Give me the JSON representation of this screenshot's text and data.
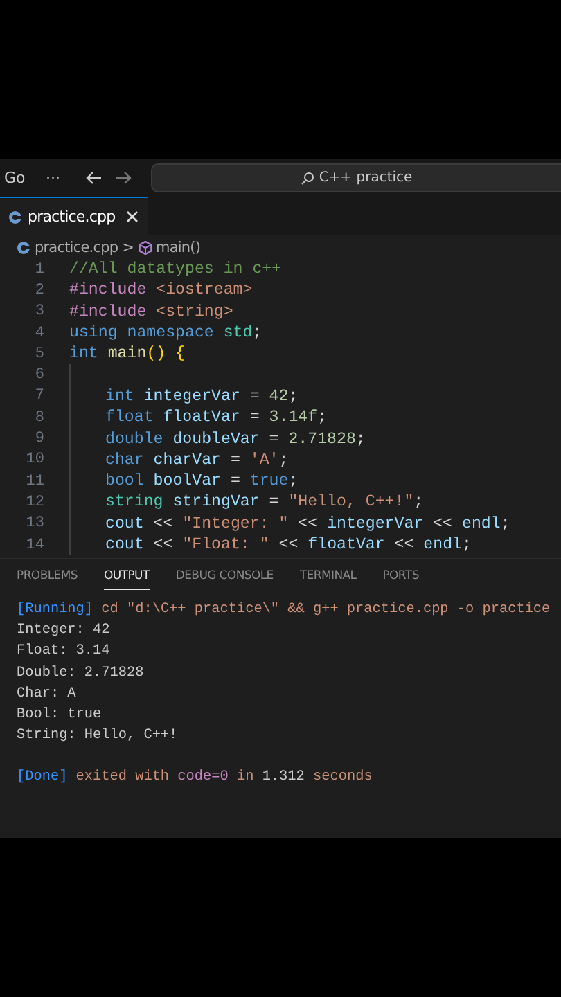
{
  "title_bar": {
    "menu": "Go",
    "more": "···",
    "search": "C++ practice"
  },
  "tabs": [
    {
      "label": "practice.cpp",
      "selected": true
    }
  ],
  "breadcrumbs": {
    "file": "practice.cpp",
    "separator": ">",
    "symbol": "main()"
  },
  "code": {
    "lines": [
      {
        "number": "1",
        "indent": false,
        "tokens": [
          {
            "text": "//All datatypes in c++",
            "kind": "comment"
          }
        ]
      },
      {
        "number": "2",
        "indent": false,
        "tokens": [
          {
            "text": "#include ",
            "kind": "directive"
          },
          {
            "text": "<iostream>",
            "kind": "string"
          }
        ]
      },
      {
        "number": "3",
        "indent": false,
        "tokens": [
          {
            "text": "#include ",
            "kind": "directive"
          },
          {
            "text": "<string>",
            "kind": "string"
          }
        ]
      },
      {
        "number": "4",
        "indent": false,
        "tokens": [
          {
            "text": "using namespace ",
            "kind": "keyword"
          },
          {
            "text": "std",
            "kind": "type"
          },
          {
            "text": ";",
            "kind": "plain"
          }
        ]
      },
      {
        "number": "5",
        "indent": false,
        "tokens": [
          {
            "text": "int ",
            "kind": "keyword"
          },
          {
            "text": "main",
            "kind": "function"
          },
          {
            "text": "() ",
            "kind": "bracket"
          },
          {
            "text": "{",
            "kind": "bracket"
          }
        ]
      },
      {
        "number": "6",
        "indent": true
      },
      {
        "number": "7",
        "indent": true,
        "tokens": [
          {
            "text": "int ",
            "kind": "keyword"
          },
          {
            "text": "integerVar",
            "kind": "variable"
          },
          {
            "text": " = ",
            "kind": "plain"
          },
          {
            "text": "42",
            "kind": "number"
          },
          {
            "text": ";",
            "kind": "plain"
          }
        ]
      },
      {
        "number": "8",
        "indent": true,
        "tokens": [
          {
            "text": "float ",
            "kind": "keyword"
          },
          {
            "text": "floatVar",
            "kind": "variable"
          },
          {
            "text": " = ",
            "kind": "plain"
          },
          {
            "text": "3.14f",
            "kind": "number"
          },
          {
            "text": ";",
            "kind": "plain"
          }
        ]
      },
      {
        "number": "9",
        "indent": true,
        "tokens": [
          {
            "text": "double ",
            "kind": "keyword"
          },
          {
            "text": "doubleVar",
            "kind": "variable"
          },
          {
            "text": " = ",
            "kind": "plain"
          },
          {
            "text": "2.71828",
            "kind": "number"
          },
          {
            "text": ";",
            "kind": "plain"
          }
        ]
      },
      {
        "number": "10",
        "indent": true,
        "tokens": [
          {
            "text": "char ",
            "kind": "keyword"
          },
          {
            "text": "charVar",
            "kind": "variable"
          },
          {
            "text": " = ",
            "kind": "plain"
          },
          {
            "text": "'A'",
            "kind": "string"
          },
          {
            "text": ";",
            "kind": "plain"
          }
        ]
      },
      {
        "number": "11",
        "indent": true,
        "tokens": [
          {
            "text": "bool ",
            "kind": "keyword"
          },
          {
            "text": "boolVar",
            "kind": "variable"
          },
          {
            "text": " = ",
            "kind": "plain"
          },
          {
            "text": "true",
            "kind": "keyword"
          },
          {
            "text": ";",
            "kind": "plain"
          }
        ]
      },
      {
        "number": "12",
        "indent": true,
        "tokens": [
          {
            "text": "string ",
            "kind": "type"
          },
          {
            "text": "stringVar",
            "kind": "variable"
          },
          {
            "text": " = ",
            "kind": "plain"
          },
          {
            "text": "\"Hello, C++!\"",
            "kind": "string"
          },
          {
            "text": ";",
            "kind": "plain"
          }
        ]
      },
      {
        "number": "13",
        "indent": true,
        "tokens": [
          {
            "text": "cout",
            "kind": "variable"
          },
          {
            "text": " << ",
            "kind": "plain"
          },
          {
            "text": "\"Integer: \"",
            "kind": "string"
          },
          {
            "text": " << ",
            "kind": "plain"
          },
          {
            "text": "integerVar",
            "kind": "variable"
          },
          {
            "text": " << ",
            "kind": "plain"
          },
          {
            "text": "endl",
            "kind": "variable"
          },
          {
            "text": ";",
            "kind": "plain"
          }
        ]
      },
      {
        "number": "14",
        "indent": true,
        "tokens": [
          {
            "text": "cout",
            "kind": "variable"
          },
          {
            "text": " << ",
            "kind": "plain"
          },
          {
            "text": "\"Float: \"",
            "kind": "string"
          },
          {
            "text": " << ",
            "kind": "plain"
          },
          {
            "text": "floatVar",
            "kind": "variable"
          },
          {
            "text": " << ",
            "kind": "plain"
          },
          {
            "text": "endl",
            "kind": "variable"
          },
          {
            "text": ";",
            "kind": "plain"
          }
        ]
      }
    ]
  },
  "panel": {
    "tabs": [
      {
        "label": "PROBLEMS",
        "selected": false
      },
      {
        "label": "OUTPUT",
        "selected": true
      },
      {
        "label": "DEBUG CONSOLE",
        "selected": false
      },
      {
        "label": "TERMINAL",
        "selected": false
      },
      {
        "label": "PORTS",
        "selected": false
      }
    ],
    "output": [
      {
        "tokens": [
          {
            "text": "[Running]",
            "kind": "tag"
          },
          {
            "text": " cd \"d:\\C++ practice\\\" && g++ practice.cpp -o practice",
            "kind": "command"
          }
        ]
      },
      {
        "tokens": [
          {
            "text": "Integer: 42",
            "kind": "plain"
          }
        ]
      },
      {
        "tokens": [
          {
            "text": "Float: 3.14",
            "kind": "plain"
          }
        ]
      },
      {
        "tokens": [
          {
            "text": "Double: 2.71828",
            "kind": "plain"
          }
        ]
      },
      {
        "tokens": [
          {
            "text": "Char: A",
            "kind": "plain"
          }
        ]
      },
      {
        "tokens": [
          {
            "text": "Bool: true",
            "kind": "plain"
          }
        ]
      },
      {
        "tokens": [
          {
            "text": "String: Hello, C++!",
            "kind": "plain"
          }
        ]
      },
      {
        "kind": "summary",
        "tokens": [
          {
            "text": "[Done]",
            "kind": "tag"
          },
          {
            "text": " exited with ",
            "kind": "command"
          },
          {
            "text": "code=0",
            "kind": "keyword"
          },
          {
            "text": " in ",
            "kind": "command"
          },
          {
            "text": "1.312",
            "kind": "plain"
          },
          {
            "text": " seconds",
            "kind": "command"
          }
        ]
      }
    ]
  }
}
